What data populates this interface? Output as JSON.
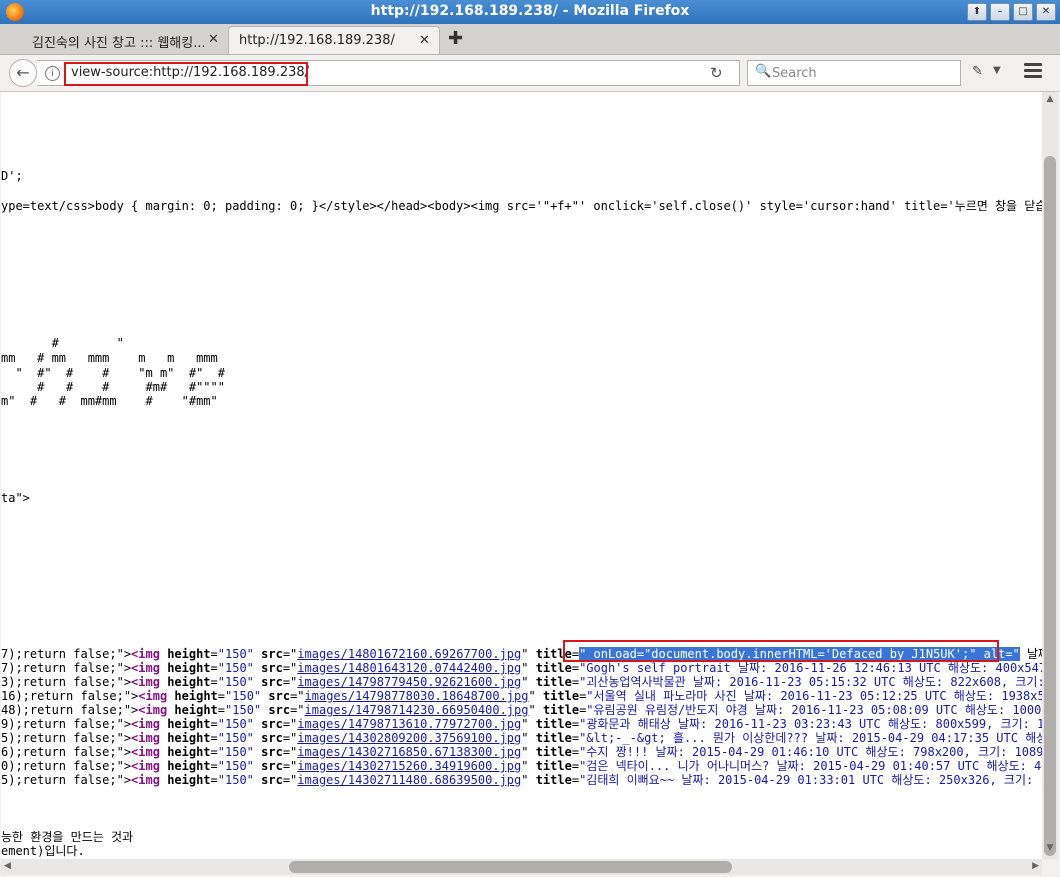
{
  "window": {
    "title": "http://192.168.189.238/ - Mozilla Firefox",
    "buttons": [
      "⬆",
      "–",
      "□",
      "✕"
    ]
  },
  "tabs": [
    {
      "label": "김진숙의 사진 창고 ::: 웹해킹...",
      "close": "✕"
    },
    {
      "label": "http://192.168.189.238/",
      "close": "✕"
    }
  ],
  "newtab": "✚",
  "nav": {
    "back": "←",
    "info": "i",
    "url": "view-source:http://192.168.189.238/",
    "reload": "↻",
    "search_icon": "🔍",
    "search_placeholder": "Search",
    "addon": "✎",
    "addon_dropdown": "▼",
    "highlight_color": "#d9161a"
  },
  "source": {
    "line1": "D';",
    "line2": "ype=text/css>body { margin: 0; padding: 0; }</style></head><body><img src='\"+f+\"' onclick='self.close()' style='cursor:hand' title='누르면 창을 닫습니다",
    "art1": "       #        \"",
    "art2": "mm   # mm   mmm    m   m   mmm",
    "art3": "  \"  #\"  #    #    \"m m\"  #\"  #",
    "art4": "     #   #    #     #m#   #\"\"\"\"",
    "art5": "m\"  #   #  mm#mm    #    \"#mm\"",
    "line_ta": "ta\">",
    "rows": [
      {
        "pre": "7);return false;\">",
        "src": "images/14801672160.69267700.jpg",
        "title": "\" onLoad=\"document.body.innerHTML='Defaced by J1N5UK';\" alt=\"",
        "rest": " 날짜: 2"
      },
      {
        "pre": "7);return false;\">",
        "src": "images/14801643120.07442400.jpg",
        "title": "\"Gogh's self portrait 날짜: 2016-11-26 12:46:13 UTC 해상도: 400x547, 크",
        "rest": ""
      },
      {
        "pre": "3);return false;\">",
        "src": "images/14798779450.92621600.jpg",
        "title": "\"괴산농업역사박물관 날짜: 2016-11-23 05:15:32 UTC 해상도: 822x608, 크기: 1",
        "rest": ""
      },
      {
        "pre": "16);return false;\">",
        "src": "images/14798778030.18648700.jpg",
        "title": "\"서울역 실내 파노라마 사진 날짜: 2016-11-23 05:12:25 UTC 해상도: 1938x516",
        "rest": ""
      },
      {
        "pre": "48);return false;\">",
        "src": "images/14798714230.66950400.jpg",
        "title": "\"유림공원 유림정/반도지 야경 날짜: 2016-11-23 05:08:09 UTC 해상도: 1000x7",
        "rest": ""
      },
      {
        "pre": "9);return false;\">",
        "src": "images/14798713610.77972700.jpg",
        "title": "\"광화문과 해태상 날짜: 2016-11-23 03:23:43 UTC 해상도: 800x599, 크기: 142",
        "rest": ""
      },
      {
        "pre": "5);return false;\">",
        "src": "images/14302809200.37569100.jpg",
        "title": "\"&lt;-_-&gt; 흘... 뭔가 이상한데??? 날짜: 2015-04-29 04:17:35 UTC 해상도",
        "rest": ""
      },
      {
        "pre": "6);return false;\">",
        "src": "images/14302716850.67138300.jpg",
        "title": "\"수지 짱!!! 날짜: 2015-04-29 01:46:10 UTC 해상도: 798x200, 크기: 108904 ",
        "rest": ""
      },
      {
        "pre": "0);return false;\">",
        "src": "images/14302715260.34919600.jpg",
        "title": "\"검은 넥타이... 니가 어나니머스? 날짜: 2015-04-29 01:40:57 UTC 해상도: 480",
        "rest": ""
      },
      {
        "pre": "5);return false;\">",
        "src": "images/14302711480.68639500.jpg",
        "title": "\"김태희 이뻐요~~ 날짜: 2015-04-29 01:33:01 UTC 해상도: 250x326, 크기: 138",
        "rest": ""
      }
    ],
    "img_tag": "<img",
    "height_attr": "height",
    "height_val": "\"150\"",
    "src_attr": "src",
    "title_attr": "title",
    "footer1": "능한 환경을 만드는 것과",
    "footer2": "ement)입니다."
  },
  "scrollbars": {
    "up": "▲",
    "down": "▼",
    "left": "◀",
    "right": "▶"
  }
}
